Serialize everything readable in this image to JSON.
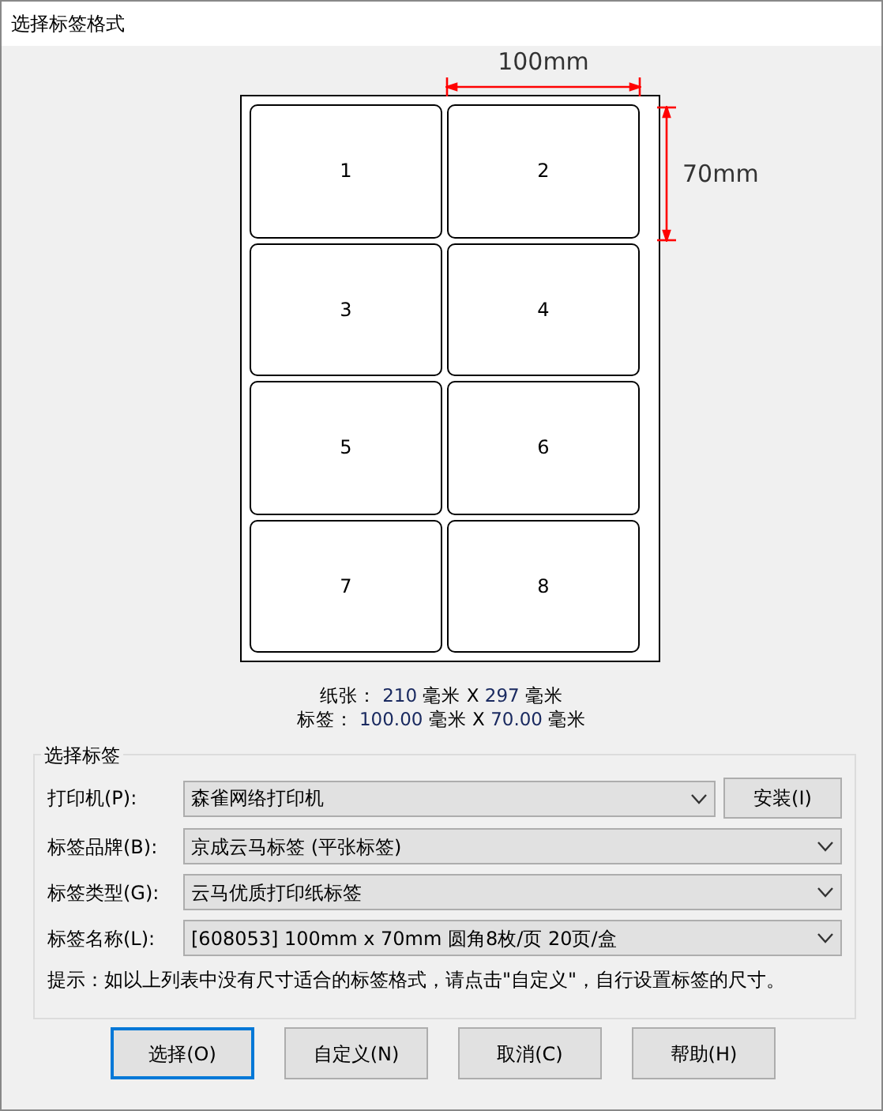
{
  "window": {
    "title": "选择标签格式"
  },
  "preview": {
    "width_dimension": "100mm",
    "height_dimension": "70mm",
    "labels": [
      "1",
      "2",
      "3",
      "4",
      "5",
      "6",
      "7",
      "8"
    ]
  },
  "size_info": [
    {
      "label": "纸张：",
      "value_1": "210",
      "unit_1": "毫米",
      "separator": "X",
      "value_2": "297",
      "unit_2": "毫米"
    },
    {
      "label": "标签：",
      "value_1": "100.00",
      "unit_1": "毫米",
      "separator": "X",
      "value_2": "70.00",
      "unit_2": "毫米"
    }
  ],
  "group": {
    "title": "选择标签",
    "fields": [
      {
        "label": "打印机(P):",
        "value": "森雀网络打印机",
        "button": "安装(I)"
      },
      {
        "label": "标签品牌(B):",
        "value": "京成云马标签 (平张标签)"
      },
      {
        "label": "标签类型(G):",
        "value": "云马优质打印纸标签"
      },
      {
        "label": "标签名称(L):",
        "value": "[608053] 100mm x 70mm 圆角8枚/页 20页/盒"
      }
    ],
    "hint": "提示：如以上列表中没有尺寸适合的标签格式，请点击\"自定义\"，自行设置标签的尺寸。"
  },
  "buttons": [
    {
      "label": "选择(O)",
      "default": true
    },
    {
      "label": "自定义(N)",
      "default": false
    },
    {
      "label": "取消(C)",
      "default": false
    },
    {
      "label": "帮助(H)",
      "default": false
    }
  ]
}
